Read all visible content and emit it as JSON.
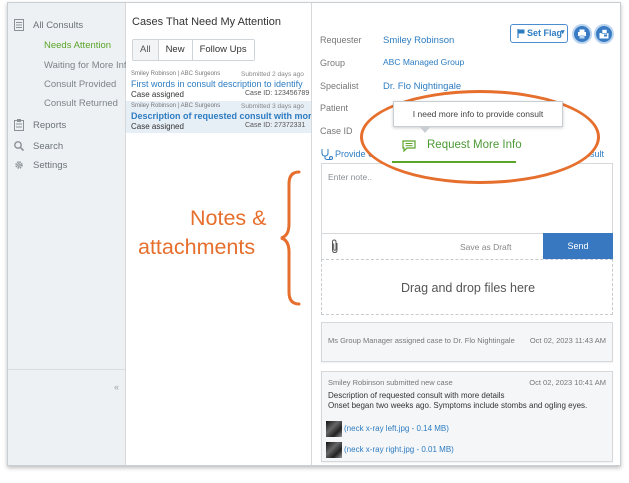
{
  "sidebar": {
    "all_consults": "All Consults",
    "items": [
      {
        "label": "Needs Attention",
        "active": true
      },
      {
        "label": "Waiting for More Info"
      },
      {
        "label": "Consult Provided"
      },
      {
        "label": "Consult Returned"
      }
    ],
    "reports": "Reports",
    "search": "Search",
    "settings": "Settings",
    "collapse": "«"
  },
  "caselist": {
    "title": "Cases That Need My Attention",
    "tabs": [
      "All",
      "New",
      "Follow Ups"
    ],
    "cases": [
      {
        "meta": "Smiley Robinson | ABC Surgeons",
        "submitted": "Submitted 2 days ago",
        "desc": "First words in consult description to identify",
        "status": "Case assigned",
        "case_id": "Case ID: 123456789"
      },
      {
        "meta": "Smiley Robinson | ABC Surgeons",
        "submitted": "Submitted 3 days ago",
        "desc": "Description of requested consult with more",
        "status": "Case assigned",
        "case_id": "Case ID: 27372331"
      }
    ]
  },
  "detail": {
    "labels": {
      "requester": "Requester",
      "group": "Group",
      "specialist": "Specialist",
      "patient": "Patient",
      "case_id": "Case ID"
    },
    "requester": "Smiley Robinson",
    "group": "ABC Managed Group",
    "specialist": "Dr. Flo Nightingale",
    "set_flag": "Set Flag",
    "flag_caret": "▾",
    "provide_consult": "Provide Consult",
    "consult_right": "nsult",
    "note_placeholder": "Enter note..",
    "save_draft": "Save as Draft",
    "send": "Send",
    "drop_text": "Drag and drop files here",
    "activity": [
      {
        "text": "Ms Group Manager assigned case to Dr. Flo Nightingale",
        "date": "Oct 02, 2023  11:43 AM"
      },
      {
        "header": "Smiley Robinson submitted new case",
        "date": "Oct 02, 2023  10:41 AM",
        "line1": "Description of requested consult with more details",
        "line2": "Onset began two weeks ago. Symptoms include stombs and ogling eyes.",
        "attachments": [
          "(neck x-ray left.jpg - 0.14 MB)",
          "(neck x-ray right.jpg - 0.01 MB)"
        ]
      }
    ]
  },
  "popover": {
    "tooltip": "I need more info to provide consult",
    "request": "Request More Info"
  },
  "annotation": {
    "line1": "Notes &",
    "line2": "attachments"
  },
  "colors": {
    "accent": "#2d7cc1",
    "green": "#5aa52a",
    "annotation": "#e66f2d",
    "send": "#3778c0"
  }
}
